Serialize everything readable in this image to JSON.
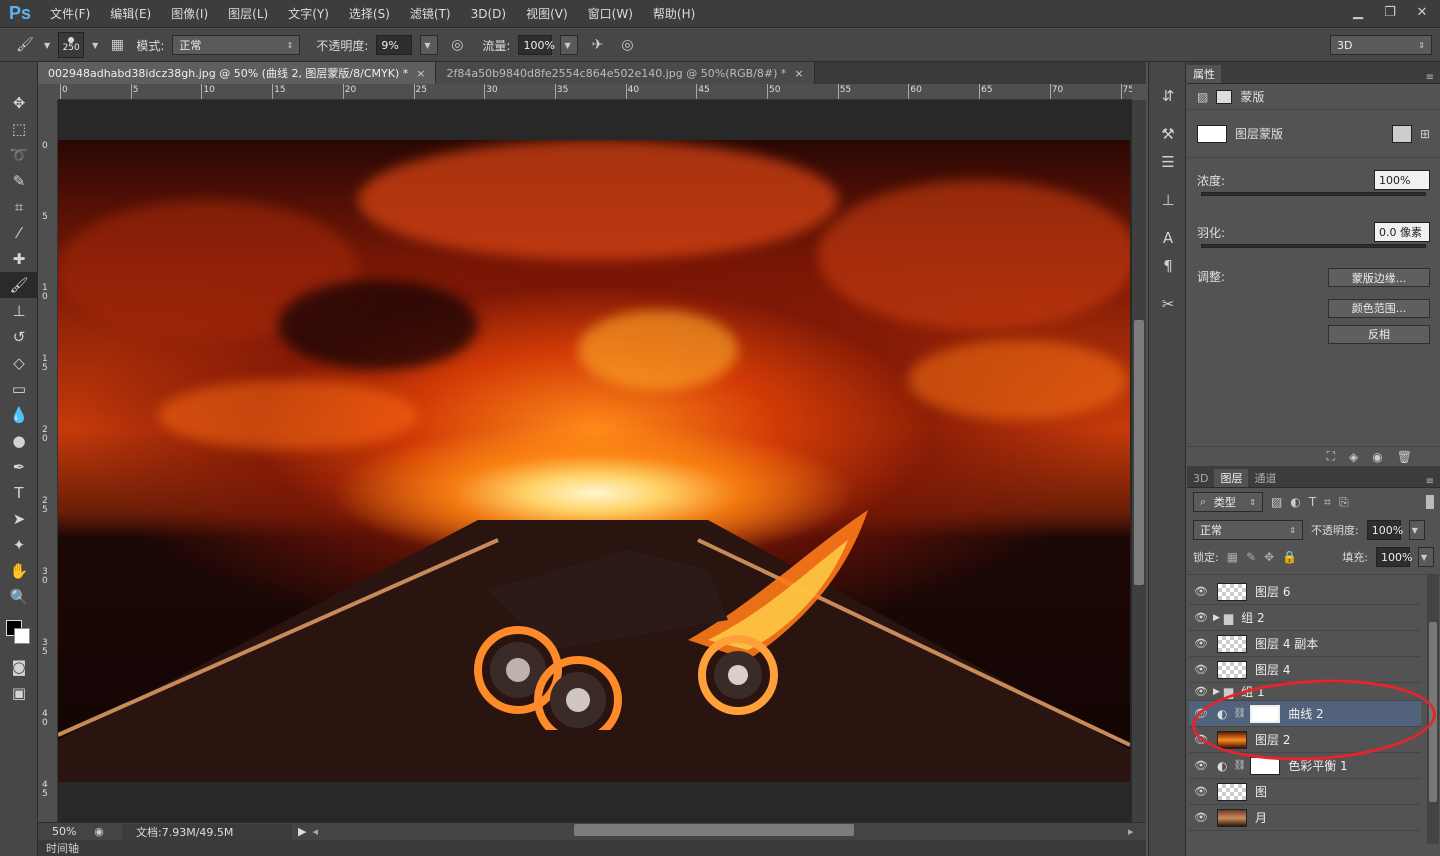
{
  "menu": {
    "logo": "Ps",
    "items": [
      "文件(F)",
      "编辑(E)",
      "图像(I)",
      "图层(L)",
      "文字(Y)",
      "选择(S)",
      "滤镜(T)",
      "3D(D)",
      "视图(V)",
      "窗口(W)",
      "帮助(H)"
    ]
  },
  "options": {
    "brush_size": "250",
    "mode_label": "模式:",
    "mode_value": "正常",
    "opacity_label": "不透明度:",
    "opacity_value": "9%",
    "flow_label": "流量:",
    "flow_value": "100%",
    "workspace": "3D"
  },
  "tabs": [
    {
      "title": "002948adhabd38idcz38gh.jpg @ 50% (曲线 2, 图层蒙版/8/CMYK) *",
      "close": "×"
    },
    {
      "title": "2f84a50b9840d8fe2554c864e502e140.jpg @ 50%(RGB/8#) *",
      "close": "×"
    }
  ],
  "ruler": {
    "h": [
      "0",
      "5",
      "10",
      "15",
      "20",
      "25",
      "30",
      "35",
      "40",
      "45",
      "50",
      "55",
      "60",
      "65",
      "70",
      "75"
    ],
    "v": [
      "0",
      "5",
      "1\n0",
      "1\n5",
      "2\n0",
      "2\n5",
      "3\n0",
      "3\n5",
      "4\n0",
      "4\n5"
    ]
  },
  "status": {
    "zoom": "50%",
    "doc": "文档:7.93M/49.5M",
    "timeline": "时间轴"
  },
  "properties": {
    "tab": "属性",
    "mask_title": "蒙版",
    "layer_mask": "图层蒙版",
    "density_label": "浓度:",
    "density_value": "100%",
    "feather_label": "羽化:",
    "feather_value": "0.0 像素",
    "adjust_label": "调整:",
    "btn_edge": "蒙版边缘...",
    "btn_color_range": "颜色范围...",
    "btn_invert": "反相"
  },
  "layers_panel": {
    "tabs": [
      "3D",
      "图层",
      "通道"
    ],
    "filter": "类型",
    "blend": "正常",
    "opacity_label": "不透明度:",
    "opacity_value": "100%",
    "lock_label": "锁定:",
    "fill_label": "填充:",
    "fill_value": "100%",
    "layers": [
      {
        "name": "图层 6"
      },
      {
        "name": "组 2"
      },
      {
        "name": "图层 4 副本"
      },
      {
        "name": "图层 4"
      },
      {
        "name": "组 1"
      },
      {
        "name": "曲线 2"
      },
      {
        "name": "图层 2"
      },
      {
        "name": "色彩平衡 1"
      },
      {
        "name": "图"
      },
      {
        "name": "月"
      }
    ]
  },
  "colors": {
    "accent": "#5fb3f0",
    "selected_layer": "#52627a",
    "annotation": "#e5242b"
  }
}
